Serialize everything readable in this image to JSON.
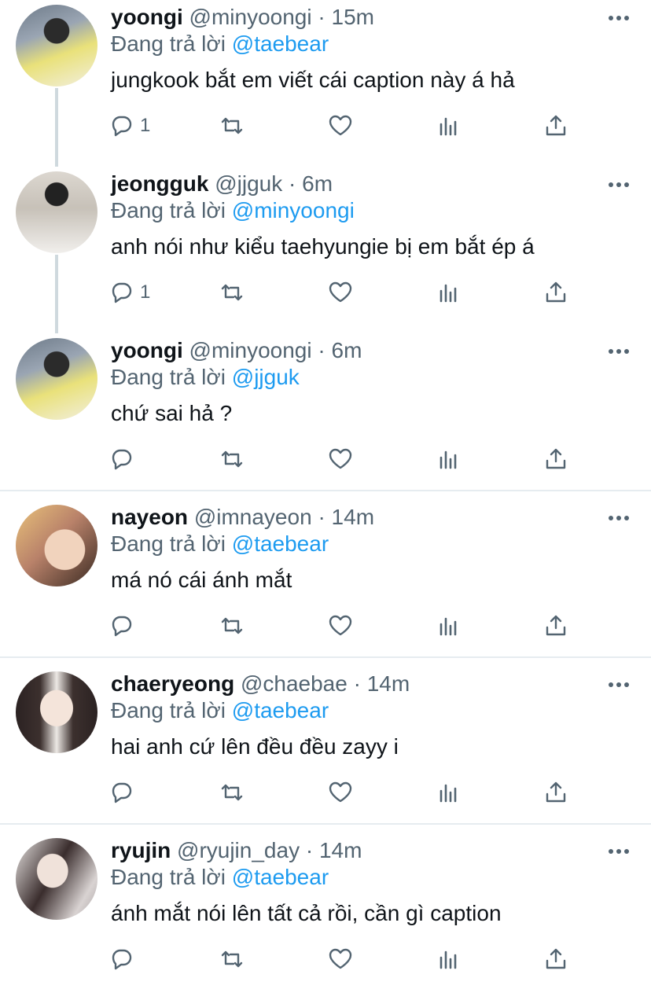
{
  "tweets": [
    {
      "name": "yoongi",
      "handle": "@minyoongi",
      "dot": "·",
      "time": "15m",
      "reply_prefix": "Đang trả lời",
      "reply_to": "@taebear",
      "text": "jungkook bắt em viết cái caption này á hả",
      "replies": "1",
      "avatar_color": "#c9c37d"
    },
    {
      "name": "jeongguk",
      "handle": "@jjguk",
      "dot": "·",
      "time": "6m",
      "reply_prefix": "Đang trả lời",
      "reply_to": "@minyoongi",
      "text": "anh nói như kiểu taehyungie bị em bắt ép á",
      "replies": "1",
      "avatar_color": "#cfcac3"
    },
    {
      "name": "yoongi",
      "handle": "@minyoongi",
      "dot": "·",
      "time": "6m",
      "reply_prefix": "Đang trả lời",
      "reply_to": "@jjguk",
      "text": "chứ sai hả ?",
      "replies": "",
      "avatar_color": "#c9c37d"
    },
    {
      "name": "nayeon",
      "handle": "@imnayeon",
      "dot": "·",
      "time": "14m",
      "reply_prefix": "Đang trả lời",
      "reply_to": "@taebear",
      "text": "má nó cái ánh mắt",
      "replies": "",
      "avatar_color": "#d9a77f"
    },
    {
      "name": "chaeryeong",
      "handle": "@chaebae",
      "dot": "·",
      "time": "14m",
      "reply_prefix": "Đang trả lời",
      "reply_to": "@taebear",
      "text": "hai anh cứ lên đều đều zayy i",
      "replies": "",
      "avatar_color": "#d8d2cc"
    },
    {
      "name": "ryujin",
      "handle": "@ryujin_day",
      "dot": "·",
      "time": "14m",
      "reply_prefix": "Đang trả lời",
      "reply_to": "@taebear",
      "text": "ánh mắt nói lên tất cả rồi, cần gì caption",
      "replies": "",
      "avatar_color": "#cbc3c4"
    }
  ],
  "icons": {
    "reply": "reply-icon",
    "retweet": "retweet-icon",
    "like": "heart-icon",
    "analytics": "analytics-icon",
    "share": "share-icon",
    "more": "more-icon"
  },
  "colors": {
    "link": "#1d9bf0",
    "secondary": "#536471",
    "divider": "#e6ecf0",
    "thread": "#cfd9de"
  }
}
